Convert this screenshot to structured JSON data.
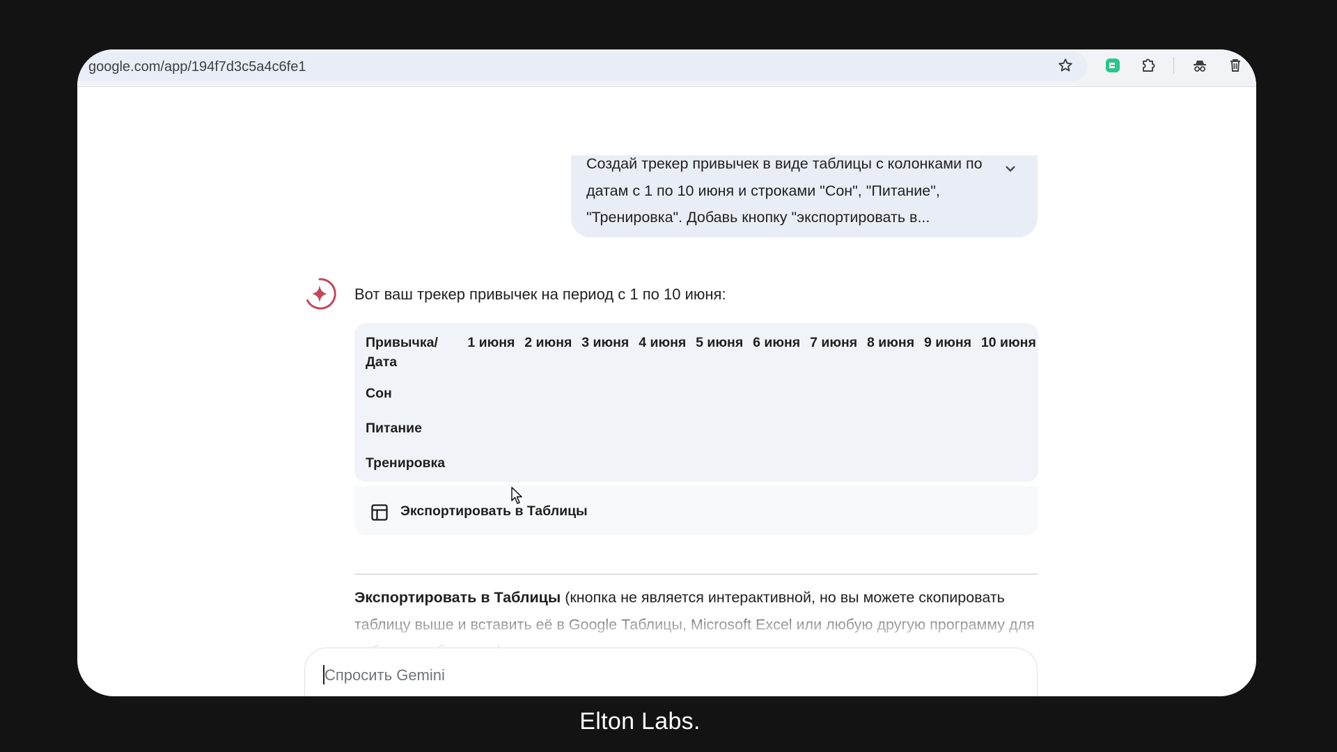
{
  "browser": {
    "url": "google.com/app/194f7d3c5a4c6fe1",
    "icons": [
      "star-icon",
      "extension-green-icon",
      "puzzle-icon",
      "incognito-icon",
      "trash-icon"
    ]
  },
  "user_message": {
    "text": "Создай трекер привычек в виде таблицы с колонками по датам с 1 по 10 июня и строками \"Сон\", \"Питание\", \"Тренировка\". Добавь кнопку \"экспортировать в...",
    "expand_icon": "chevron-down-icon"
  },
  "response": {
    "intro": "Вот ваш трекер привычек на период с 1 по 10 июня:",
    "table": {
      "header_first": "Привычка/ Дата",
      "dates": [
        "1 июня",
        "2 июня",
        "3 июня",
        "4 июня",
        "5 июня",
        "6 июня",
        "7 июня",
        "8 июня",
        "9 июня",
        "10 июня"
      ],
      "rows": [
        "Сон",
        "Питание",
        "Тренировка"
      ]
    },
    "export_button": "Экспортировать в Таблицы",
    "note_bold": "Экспортировать в Таблицы",
    "note_text": " (кнопка не является интерактивной, но вы можете скопировать таблицу выше и вставить её в Google Таблицы, Microsoft Excel или любую другую программу для работы с таблицами)."
  },
  "input": {
    "placeholder": "Спросить Gemini"
  },
  "watermark": "Elton Labs.",
  "colors": {
    "background": "#131313",
    "bubble": "#e9eef6",
    "table_card": "#f0f4f9",
    "gemini_accent": "#c0485a"
  }
}
